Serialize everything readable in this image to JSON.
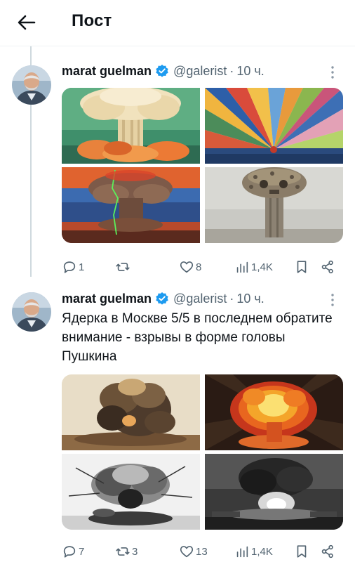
{
  "header": {
    "title": "Пост",
    "back_icon": "arrow-left-icon"
  },
  "colors": {
    "text": "#0f1419",
    "secondary": "#536471",
    "verified": "#1d9bf0",
    "divider": "#eff3f4",
    "thread_line": "#cfd9de"
  },
  "tweets": [
    {
      "author": "marat guelman",
      "handle": "@galerist",
      "separator": "·",
      "time": "10 ч.",
      "text": "",
      "images": [
        "nuclear-mushroom-cloud-painting",
        "rainbow-rays-painting",
        "nuclear-explosion-lightning-painting",
        "skull-mushroom-cloud-painting"
      ],
      "stats": {
        "replies": "1",
        "reposts": "",
        "likes": "8",
        "views": "1,4K"
      }
    },
    {
      "author": "marat guelman",
      "handle": "@galerist",
      "separator": "·",
      "time": "10 ч.",
      "text": "Ядерка в Москве 5/5 в последнем обратите внимание - взрывы в форме головы Пушкина",
      "images": [
        "explosion-sepia-drawing",
        "fiery-explosion-illustration",
        "ink-explosion-sketch",
        "dark-explosion-photo"
      ],
      "stats": {
        "replies": "7",
        "reposts": "3",
        "likes": "13",
        "views": "1,4K"
      }
    }
  ]
}
